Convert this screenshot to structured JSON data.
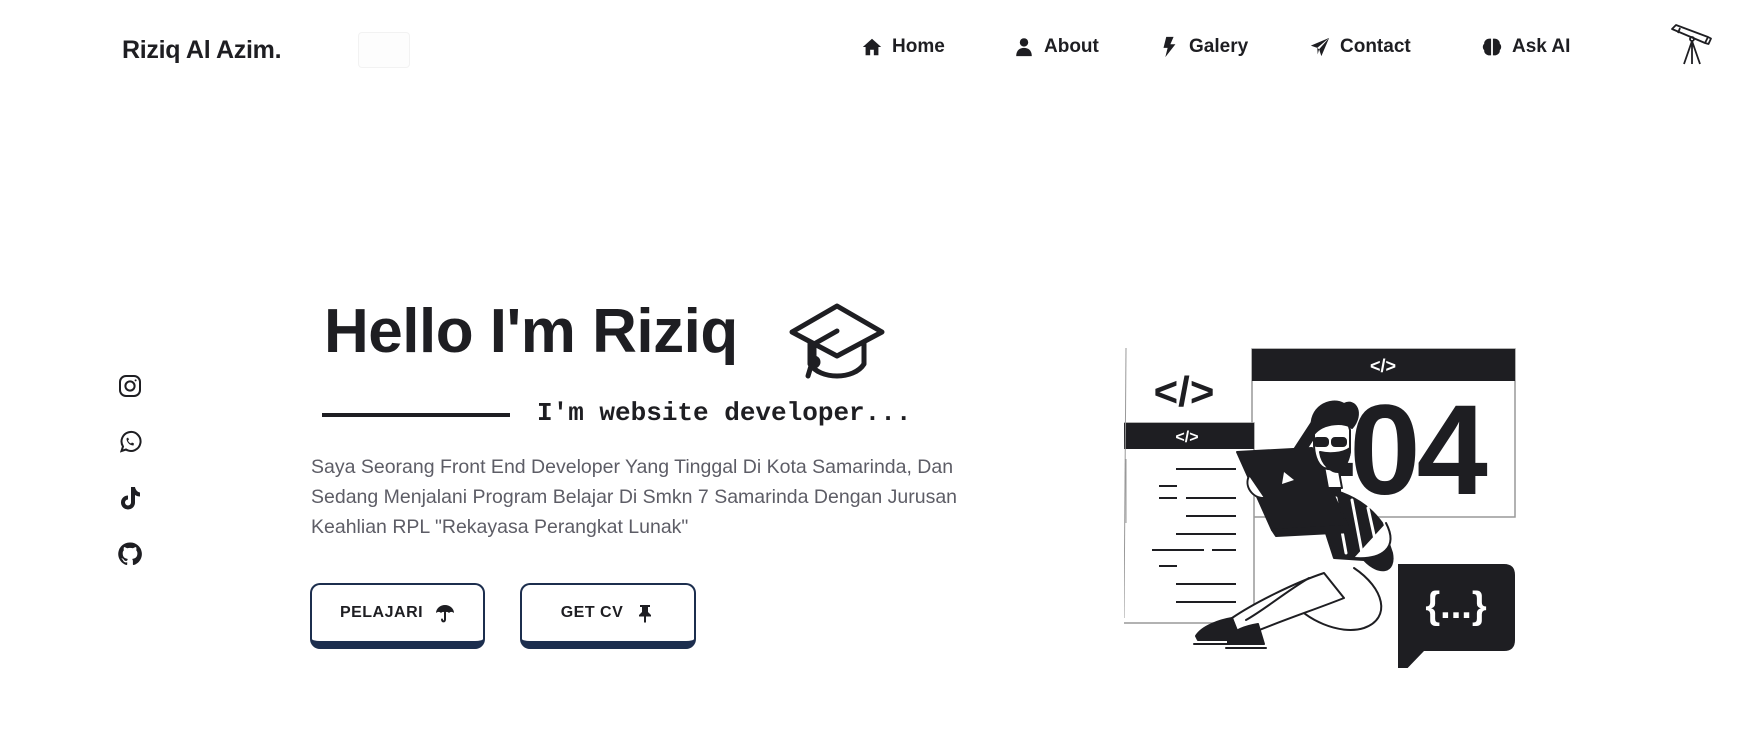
{
  "brand": {
    "name": "Riziq Al Azim."
  },
  "nav": {
    "items": [
      {
        "label": "Home",
        "icon": "home-icon"
      },
      {
        "label": "About",
        "icon": "user-icon"
      },
      {
        "label": "Galery",
        "icon": "bolt-icon"
      },
      {
        "label": "Contact",
        "icon": "paper-plane-icon"
      },
      {
        "label": "Ask AI",
        "icon": "brain-icon"
      }
    ],
    "extra_icon": "telescope-icon"
  },
  "socials": [
    {
      "icon": "instagram-icon"
    },
    {
      "icon": "whatsapp-icon"
    },
    {
      "icon": "tiktok-icon"
    },
    {
      "icon": "github-icon"
    }
  ],
  "hero": {
    "title": "Hello I'm Riziq",
    "title_icon": "graduation-cap-icon",
    "subtitle": "I'm website developer...",
    "description": "Saya Seorang Front End Developer Yang Tinggal Di Kota Samarinda, Dan Sedang Menjalani Program Belajar Di Smkn 7 Samarinda Dengan Jurusan Keahlian RPL \"Rekayasa Perangkat Lunak\"",
    "buttons": [
      {
        "label": "PELAJARI",
        "icon": "umbrella-icon"
      },
      {
        "label": "GET CV",
        "icon": "pin-icon"
      }
    ]
  },
  "illustration": {
    "code_tag": "</>",
    "error_code": "404",
    "brace_label": "{...}"
  },
  "colors": {
    "text": "#1e1e22",
    "muted": "#5d5d66",
    "button_border": "#1c2e4e",
    "background": "#ffffff"
  }
}
